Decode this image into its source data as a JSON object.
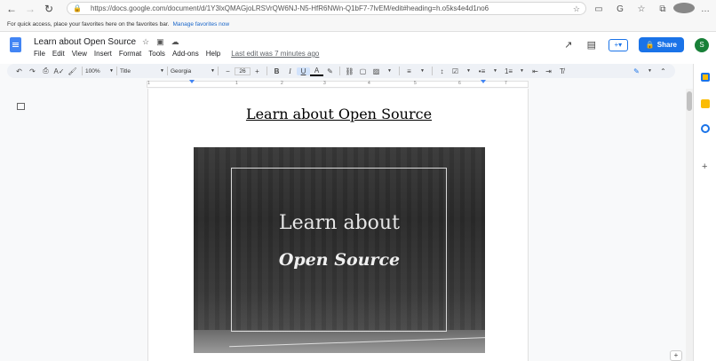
{
  "browser": {
    "url": "https://docs.google.com/document/d/1Y3lxQMAGjoLRSVrQW6NJ-N5-HfR6NWn-Q1bF7-7lvEM/edit#heading=h.o5ks4e4d1no6"
  },
  "favorites_bar": {
    "text": "For quick access, place your favorites here on the favorites bar.",
    "link": "Manage favorites now"
  },
  "doc": {
    "title": "Last edit was 7 minutes ago"
  },
  "header": {
    "doc_title": "Learn about Open Source",
    "menus": [
      "File",
      "Edit",
      "View",
      "Insert",
      "Format",
      "Tools",
      "Add-ons",
      "Help"
    ],
    "last_edit": "Last edit was 7 minutes ago",
    "share_label": "Share",
    "avatar_letter": "S"
  },
  "toolbar": {
    "zoom": "100%",
    "style": "Title",
    "font": "Georgia",
    "font_size": "26"
  },
  "ruler": {
    "numbers": [
      "1",
      "1",
      "2",
      "3",
      "4",
      "5",
      "6",
      "7"
    ]
  },
  "page": {
    "heading": "Learn about Open Source",
    "hero_line1": "Learn about",
    "hero_line2": "Open Source"
  }
}
